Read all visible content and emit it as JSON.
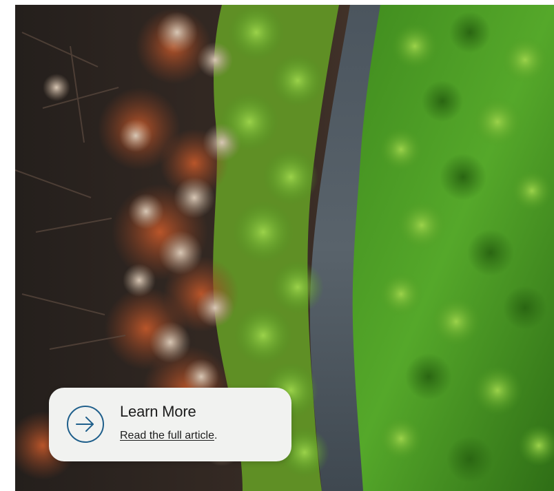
{
  "hero": {
    "image_alt": "aerial-forest-river"
  },
  "card": {
    "title": "Learn More",
    "link_text": "Read the full article",
    "link_suffix": ".",
    "icon": "arrow-right-circle-icon",
    "accent_color": "#1f5f8b"
  }
}
